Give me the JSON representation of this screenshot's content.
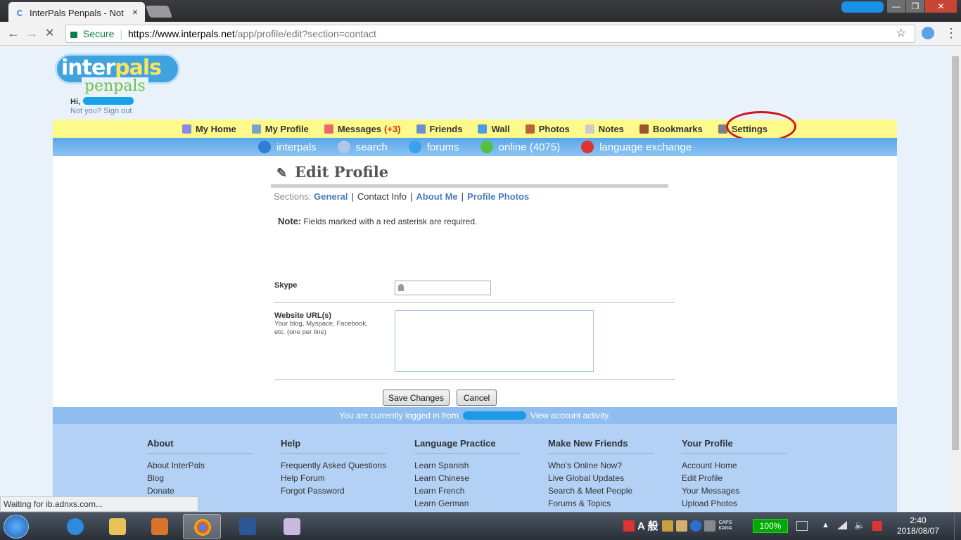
{
  "browser": {
    "tab_title": "InterPals Penpals - Not",
    "tab_close": "×",
    "back": "←",
    "forward": "→",
    "reload": "✕",
    "secure": "Secure",
    "url_host": "https://www.interpals.net",
    "url_path": "/app/profile/edit?section=contact",
    "star": "☆",
    "menu": "⋮",
    "status": "Waiting for ib.adnxs.com..."
  },
  "site": {
    "logo_inter": "inter",
    "logo_pals": "pals",
    "logo_penpals": "penpals",
    "greeting": "Hi,",
    "signout": "Not you? Sign out"
  },
  "main_nav": [
    {
      "label": "My Home",
      "icon": "home-icon",
      "color": "#8a8ae0"
    },
    {
      "label": "My Profile",
      "icon": "profile-icon",
      "color": "#7f9fcc"
    },
    {
      "label": "Messages",
      "count": "(+3)",
      "icon": "envelope-icon",
      "color": "#e86a6a"
    },
    {
      "label": "Friends",
      "icon": "friends-icon",
      "color": "#6b8fd0"
    },
    {
      "label": "Wall",
      "icon": "wall-icon",
      "color": "#4a9fe0"
    },
    {
      "label": "Photos",
      "icon": "photos-icon",
      "color": "#b8633a"
    },
    {
      "label": "Notes",
      "icon": "notes-icon",
      "color": "#cccccc"
    },
    {
      "label": "Bookmarks",
      "icon": "bookmark-icon",
      "color": "#a0522d"
    },
    {
      "label": "Settings",
      "icon": "settings-icon",
      "color": "#808080"
    }
  ],
  "sub_nav": [
    {
      "label": "interpals",
      "icon": "globe-icon",
      "color": "#2f7fd4"
    },
    {
      "label": "search",
      "icon": "magnifier-icon",
      "color": "#b0c8e8"
    },
    {
      "label": "forums",
      "icon": "speech-bubble-icon",
      "color": "#3aa0f0"
    },
    {
      "label": "online (4075)",
      "icon": "online-user-icon",
      "color": "#55c040"
    },
    {
      "label": "language exchange",
      "icon": "flags-icon",
      "color": "#d33"
    }
  ],
  "edit": {
    "pencil": "✎",
    "title": "Edit Profile",
    "sections_label": "Sections:",
    "sections": [
      "General",
      "Contact Info",
      "About Me",
      "Profile Photos"
    ],
    "note_bold": "Note:",
    "note_text": " Fields marked with a red asterisk are required.",
    "skype_label": "Skype",
    "skype_value": "",
    "website_label": "Website URL(s)",
    "website_hint": "Your blog, Myspace, Facebook, etc. (one per line)",
    "website_value": "",
    "save": "Save Changes",
    "cancel": "Cancel"
  },
  "login_bar": {
    "prefix": "You are currently logged in from",
    "link": "View account activity."
  },
  "footer": [
    {
      "title": "About",
      "links": [
        "About InterPals",
        "Blog",
        "Donate"
      ]
    },
    {
      "title": "Help",
      "links": [
        "Frequently Asked Questions",
        "Help Forum",
        "Forgot Password"
      ]
    },
    {
      "title": "Language Practice",
      "links": [
        "Learn Spanish",
        "Learn Chinese",
        "Learn French",
        "Learn German"
      ]
    },
    {
      "title": "Make New Friends",
      "links": [
        "Who's Online Now?",
        "Live Global Updates",
        "Search & Meet People",
        "Forums & Topics"
      ]
    },
    {
      "title": "Your Profile",
      "links": [
        "Account Home",
        "Edit Profile",
        "Your Messages",
        "Upload Photos"
      ]
    }
  ],
  "taskbar": {
    "ime": "A 般",
    "caps": "CAPS",
    "kana": "KANA",
    "battery": "100%",
    "time": "2:40",
    "date": "2018/08/07"
  }
}
